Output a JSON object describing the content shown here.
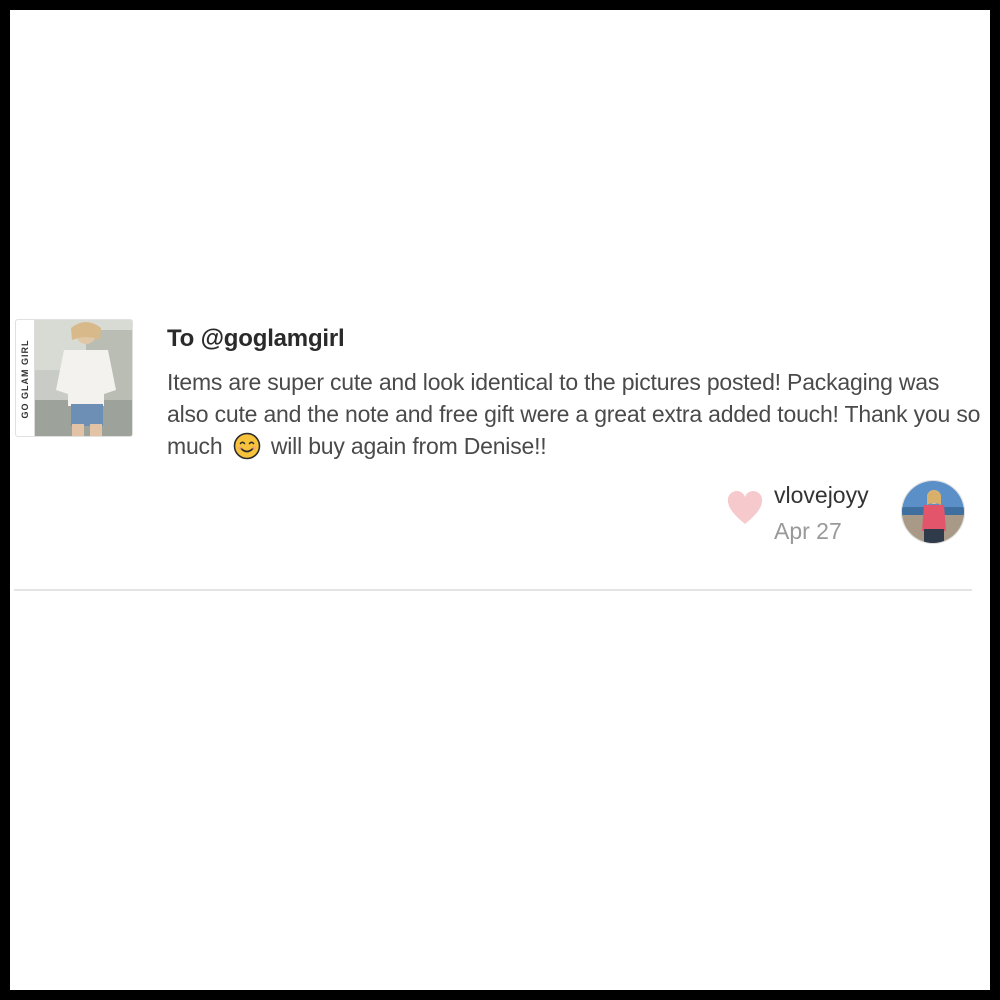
{
  "listing": {
    "brand_text": "GO GLAM GIRL"
  },
  "review": {
    "recipient": "To @goglamgirl",
    "text_before_emoji": "Items are super cute and look identical to the pictures posted! Packaging was also cute and the note and free gift were a great extra added touch! Thank you so much",
    "emoji": "smiling-face-icon",
    "text_after_emoji": "will buy again from Denise!!",
    "reviewer": "vlovejoyy",
    "date": "Apr 27",
    "liked": false
  },
  "colors": {
    "heart": "#f6c9cc",
    "emoji_face": "#f7c33c",
    "divider": "#e4e4e4",
    "date_text": "#999999"
  }
}
